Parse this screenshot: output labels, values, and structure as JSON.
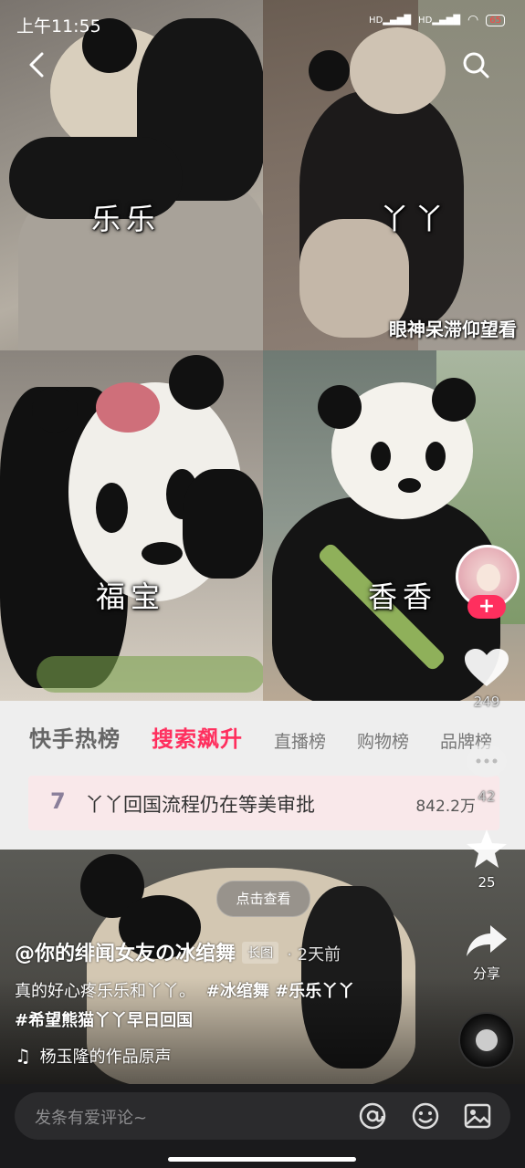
{
  "status_bar": {
    "time": "上午11:55",
    "signal1": "HD",
    "signal2": "HD",
    "battery": "65"
  },
  "tiles": [
    {
      "label": "乐乐"
    },
    {
      "label": "丫丫",
      "overlay_text": "眼神呆滞仰望看"
    },
    {
      "label": "福宝"
    },
    {
      "label": "香香"
    }
  ],
  "hot_list": {
    "tabs": [
      {
        "label": "快手热榜",
        "active": false
      },
      {
        "label": "搜索飙升",
        "active": true
      },
      {
        "label": "直播榜",
        "active": false
      },
      {
        "label": "购物榜",
        "active": false
      },
      {
        "label": "品牌榜",
        "active": false
      }
    ],
    "item": {
      "rank": "7",
      "text": "丫丫回国流程仍在等美审批",
      "count": "842.2万"
    }
  },
  "view_button": "点击查看",
  "actions": {
    "like_count": "249",
    "comment_count": "42",
    "collect_count": "25",
    "share_label": "分享",
    "follow_symbol": "+"
  },
  "post": {
    "author": "@你的绯闻女友の冰绾舞",
    "badge": "长图",
    "time": "· 2天前",
    "text_line1": "真的好心疼乐乐和丫丫。",
    "tags_line1": "#冰绾舞 #乐乐丫丫",
    "tags_line2": "#希望熊猫丫丫早日回国",
    "music": "杨玉隆的作品原声"
  },
  "comment_input": {
    "placeholder": "发条有爱评论~"
  },
  "colors": {
    "accent": "#ff2f5e",
    "hot_panel_bg": "#f9e8ea"
  }
}
